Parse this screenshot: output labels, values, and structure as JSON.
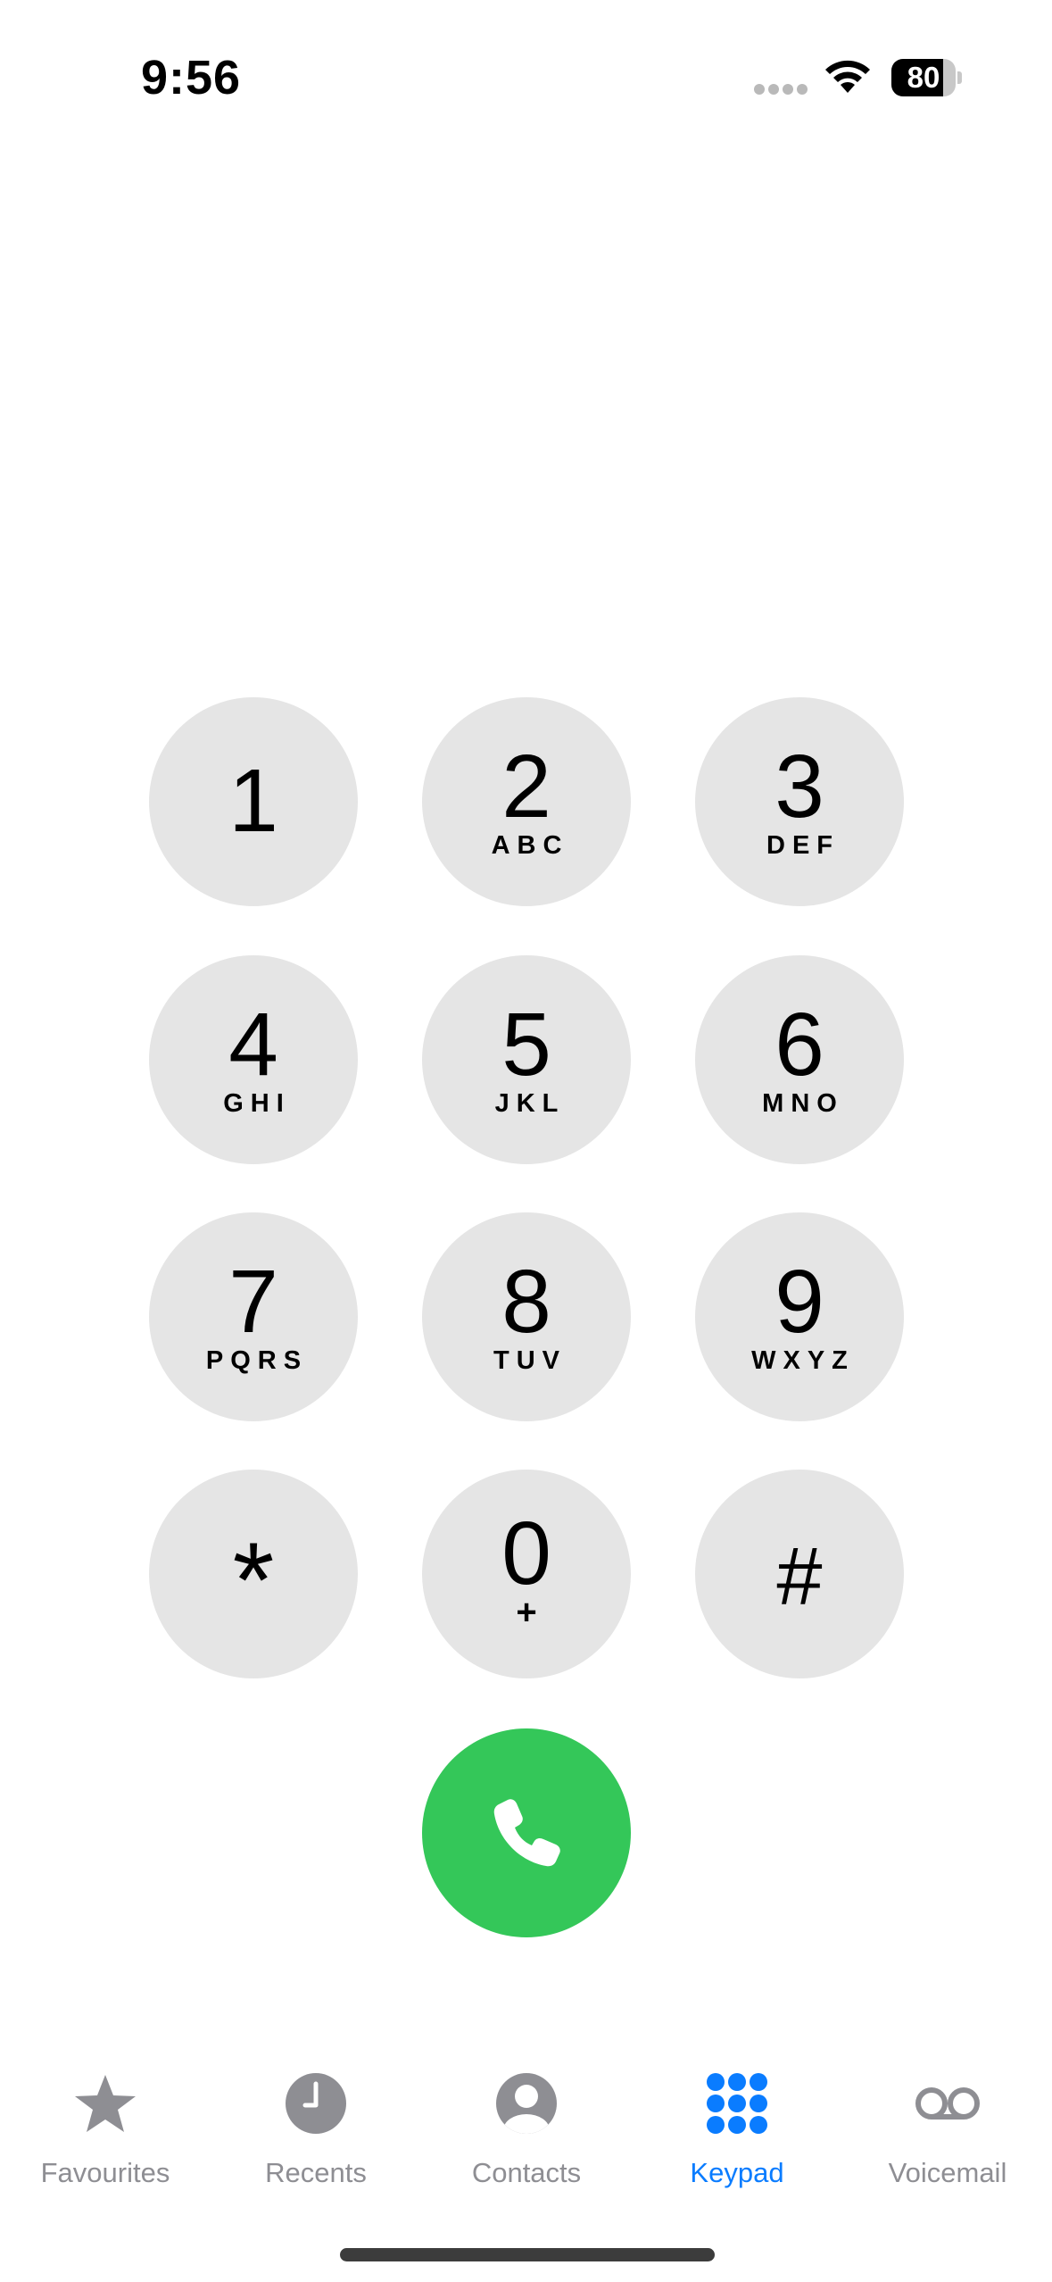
{
  "status_bar": {
    "time": "9:56",
    "battery_level": "80",
    "wifi_icon": "wifi-icon",
    "signal_icon": "cellular-no-signal-dots"
  },
  "keypad": {
    "keys": [
      {
        "digit": "1",
        "letters": ""
      },
      {
        "digit": "2",
        "letters": "ABC"
      },
      {
        "digit": "3",
        "letters": "DEF"
      },
      {
        "digit": "4",
        "letters": "GHI"
      },
      {
        "digit": "5",
        "letters": "JKL"
      },
      {
        "digit": "6",
        "letters": "MNO"
      },
      {
        "digit": "7",
        "letters": "PQRS"
      },
      {
        "digit": "8",
        "letters": "TUV"
      },
      {
        "digit": "9",
        "letters": "WXYZ"
      },
      {
        "digit": "*",
        "letters": ""
      },
      {
        "digit": "0",
        "letters": "+"
      },
      {
        "digit": "#",
        "letters": ""
      }
    ],
    "call_icon": "phone-icon"
  },
  "tab_bar": {
    "tabs": [
      {
        "label": "Favourites",
        "icon": "star-icon",
        "active": false
      },
      {
        "label": "Recents",
        "icon": "clock-icon",
        "active": false
      },
      {
        "label": "Contacts",
        "icon": "person-circle-icon",
        "active": false
      },
      {
        "label": "Keypad",
        "icon": "keypad-grid-icon",
        "active": true
      },
      {
        "label": "Voicemail",
        "icon": "voicemail-icon",
        "active": false
      }
    ]
  },
  "colors": {
    "key_background": "#e5e5e5",
    "call_green": "#34c759",
    "active_tab_blue": "#0a7cff",
    "inactive_tab_gray": "#8e8e93"
  }
}
